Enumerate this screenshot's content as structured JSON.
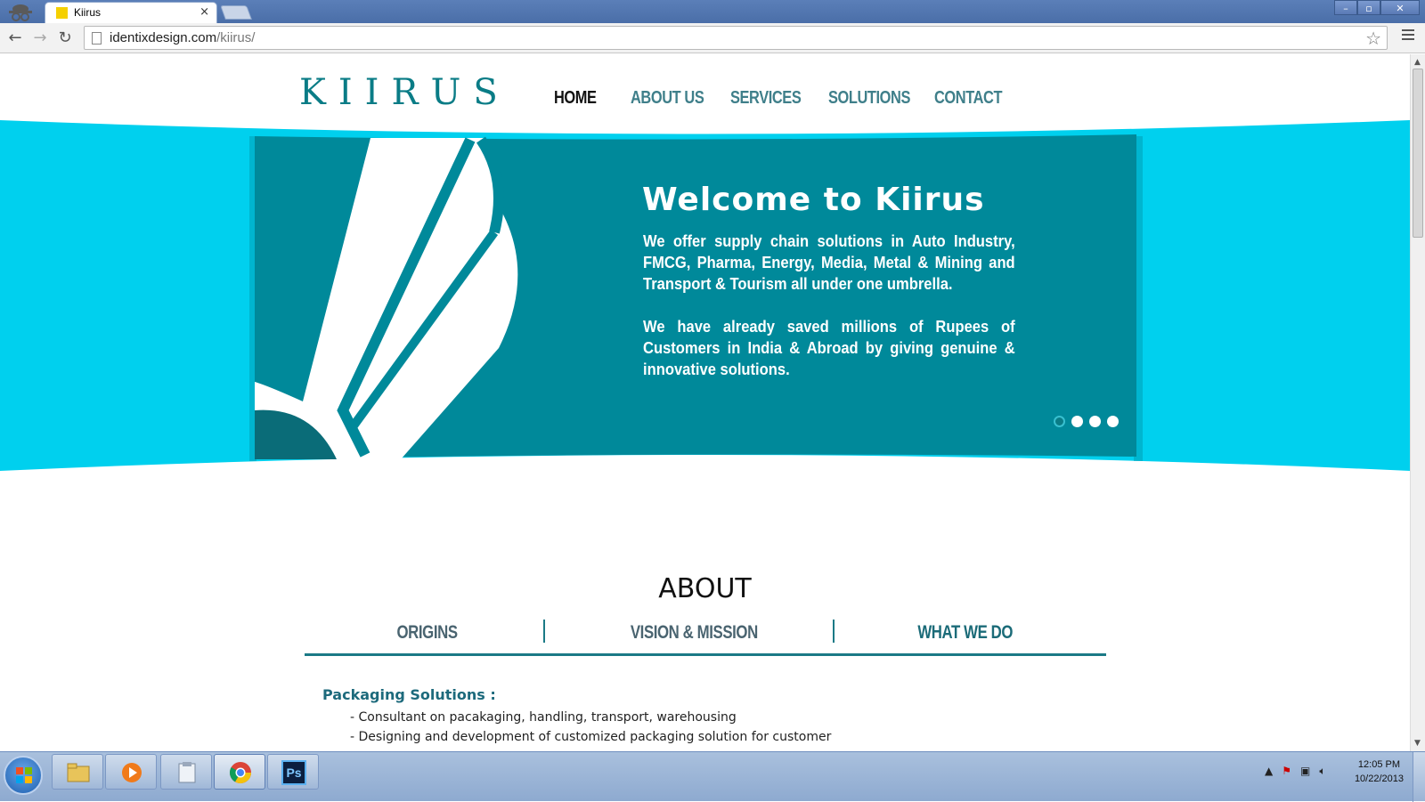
{
  "browser": {
    "tab_title": "Kiirus",
    "url_host": "identixdesign.com",
    "url_path": "/kiirus/",
    "window_buttons": [
      "–",
      "▫",
      "✕"
    ]
  },
  "site": {
    "logo": "KIIRUS",
    "nav": [
      {
        "label": "HOME",
        "active": true
      },
      {
        "label": "ABOUT US",
        "active": false
      },
      {
        "label": "SERVICES",
        "active": false
      },
      {
        "label": "SOLUTIONS",
        "active": false
      },
      {
        "label": "CONTACT",
        "active": false
      }
    ],
    "hero": {
      "title": "Welcome to Kiirus",
      "paragraph1": "We offer supply chain solutions in Auto Industry, FMCG, Pharma, Energy, Media, Metal & Mining and Transport & Tourism all under one umbrella.",
      "paragraph2": "We have already saved millions of Rupees of Customers in India & Abroad by giving genuine & innovative solutions.",
      "slides": 4,
      "active_slide": 1
    },
    "about": {
      "title": "ABOUT",
      "tabs": [
        {
          "label": "ORIGINS",
          "active": false
        },
        {
          "label": "VISION & MISSION",
          "active": false
        },
        {
          "label": "WHAT WE DO",
          "active": true
        }
      ],
      "section_heading": "Packaging Solutions :",
      "items": [
        "- Consultant on pacakaging, handling, transport, warehousing",
        "- Designing and development of customized packaging solution for customer"
      ]
    }
  },
  "taskbar": {
    "clock_time": "12:05 PM",
    "clock_date": "10/22/2013",
    "tray_icons": [
      "show-hidden-icons",
      "action-center-icon",
      "network-icon",
      "volume-icon"
    ]
  },
  "colors": {
    "teal": "#00899a",
    "cyan": "#00cfee",
    "dark_teal": "#0a6c78",
    "logo": "#0a7c86"
  }
}
